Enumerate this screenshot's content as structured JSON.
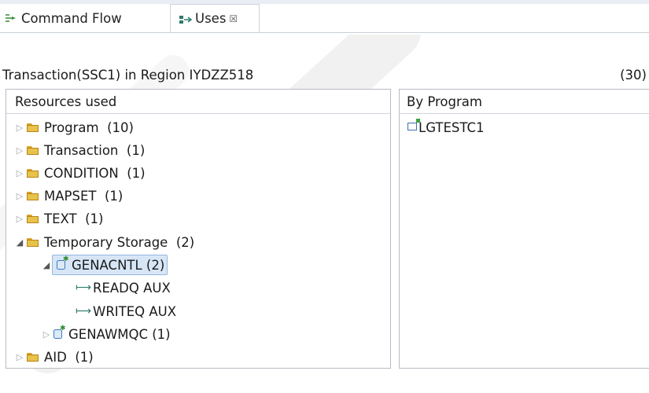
{
  "tabs": [
    {
      "label": "Command Flow",
      "icon": "command-flow-icon",
      "active": false
    },
    {
      "label": "Uses",
      "icon": "uses-icon",
      "active": true,
      "close": "☒"
    }
  ],
  "header": {
    "title": "Transaction(SSC1) in Region IYDZZ518",
    "count": "(30)"
  },
  "left_pane": {
    "heading": "Resources used",
    "items": [
      {
        "label": "Program",
        "count": "(10)"
      },
      {
        "label": "Transaction",
        "count": "(1)"
      },
      {
        "label": "CONDITION",
        "count": "(1)"
      },
      {
        "label": "MAPSET",
        "count": "(1)"
      },
      {
        "label": "TEXT",
        "count": "(1)"
      },
      {
        "label": "Temporary Storage",
        "count": "(2)"
      },
      {
        "label": "GENACNTL (2)"
      },
      {
        "label": "READQ AUX"
      },
      {
        "label": "WRITEQ AUX"
      },
      {
        "label": "GENAWMQC (1)"
      },
      {
        "label": "AID",
        "count": "(1)"
      }
    ]
  },
  "right_pane": {
    "heading": "By Program",
    "items": [
      {
        "label": "LGTESTC1"
      }
    ]
  },
  "colors": {
    "accent": "#3d6fb0",
    "folder": "#e8c24a",
    "selection": "#d7e6f7"
  }
}
